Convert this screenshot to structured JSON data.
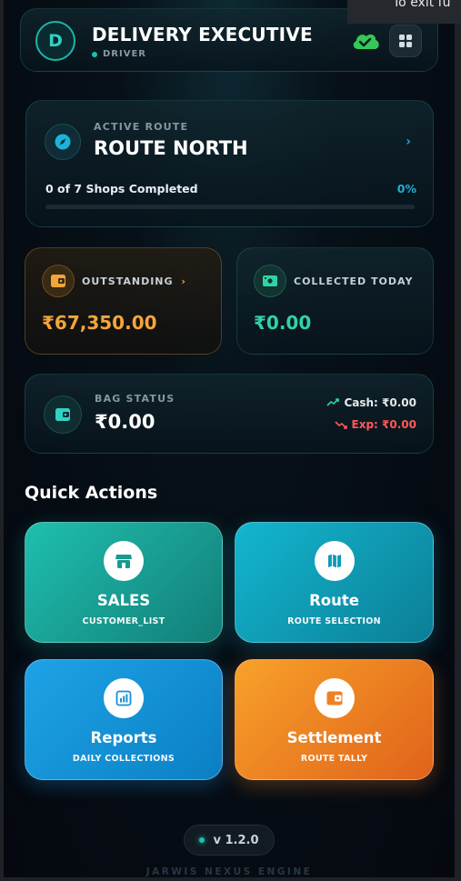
{
  "toast": {
    "text": "To exit fu"
  },
  "header": {
    "avatar_initial": "D",
    "title": "DELIVERY EXECUTIVE",
    "role": "DRIVER"
  },
  "route": {
    "label": "ACTIVE ROUTE",
    "name": "ROUTE NORTH",
    "progress_text": "0 of 7 Shops Completed",
    "progress_pct": "0%",
    "progress_fraction": 0,
    "chevron": "›"
  },
  "outstanding": {
    "label": "OUTSTANDING",
    "chevron": "›",
    "value": "₹67,350.00"
  },
  "collected": {
    "label": "COLLECTED TODAY",
    "value": "₹0.00"
  },
  "bag": {
    "label": "BAG STATUS",
    "value": "₹0.00",
    "cash": "Cash: ₹0.00",
    "exp": "Exp: ₹0.00"
  },
  "quick_actions": {
    "title": "Quick Actions",
    "items": [
      {
        "title": "SALES",
        "subtitle": "CUSTOMER_LIST",
        "icon": "store-icon"
      },
      {
        "title": "Route",
        "subtitle": "ROUTE SELECTION",
        "icon": "map-icon"
      },
      {
        "title": "Reports",
        "subtitle": "DAILY COLLECTIONS",
        "icon": "chart-icon"
      },
      {
        "title": "Settlement",
        "subtitle": "ROUTE TALLY",
        "icon": "wallet-icon"
      }
    ]
  },
  "version": "v 1.2.0",
  "footer": "JARWIS NEXUS ENGINE",
  "colors": {
    "accent_teal": "#19c2b0",
    "accent_cyan": "#1ab4d8",
    "outstanding": "#f4a53a",
    "collected": "#2fd3a8",
    "danger": "#ff5a5a",
    "cloud_green": "#34c759"
  }
}
